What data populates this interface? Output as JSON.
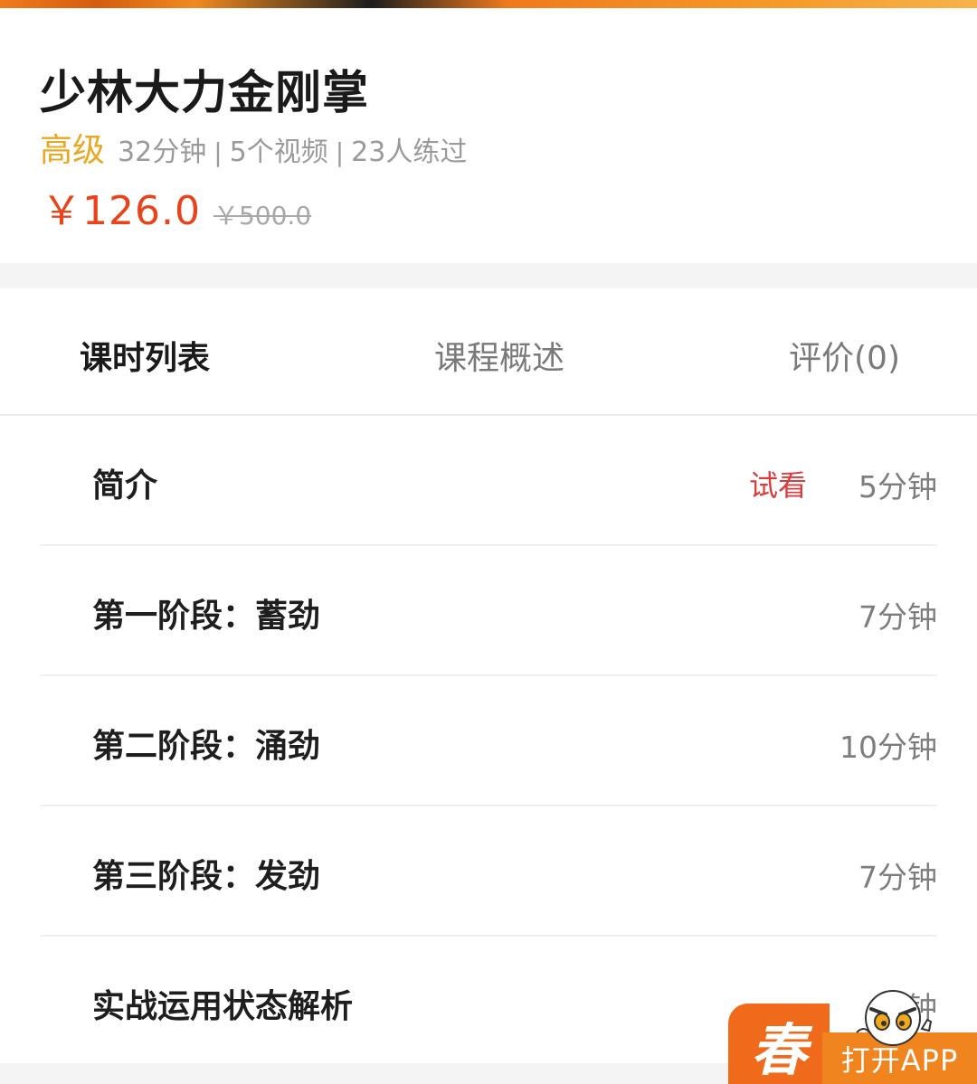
{
  "course": {
    "title": "少林大力金刚掌",
    "level": "高级",
    "duration": "32分钟",
    "videos": "5个视频",
    "learners": "23人练过",
    "separator": "|",
    "price": "￥126.0",
    "original_price": "￥500.0"
  },
  "tabs": [
    {
      "label": "课时列表",
      "active": true
    },
    {
      "label": "课程概述",
      "active": false
    },
    {
      "label": "评价(0)",
      "active": false
    }
  ],
  "lessons": [
    {
      "title": "简介",
      "preview": "试看",
      "duration": "5分钟"
    },
    {
      "title": "第一阶段：蓄劲",
      "duration": "7分钟"
    },
    {
      "title": "第二阶段：涌劲",
      "duration": "10分钟"
    },
    {
      "title": "第三阶段：发劲",
      "duration": "7分钟"
    },
    {
      "title": "实战运用状态解析",
      "duration": "钟"
    }
  ],
  "app_promo": {
    "logo_char": "春",
    "label": "打开APP"
  },
  "colors": {
    "accent_orange": "#f0841e",
    "price_red": "#e8431a",
    "level_gold": "#e8a823",
    "preview_red": "#d83d3d"
  },
  "icons": {
    "mascot": "mascot-icon",
    "app_logo": "app-logo-icon"
  }
}
